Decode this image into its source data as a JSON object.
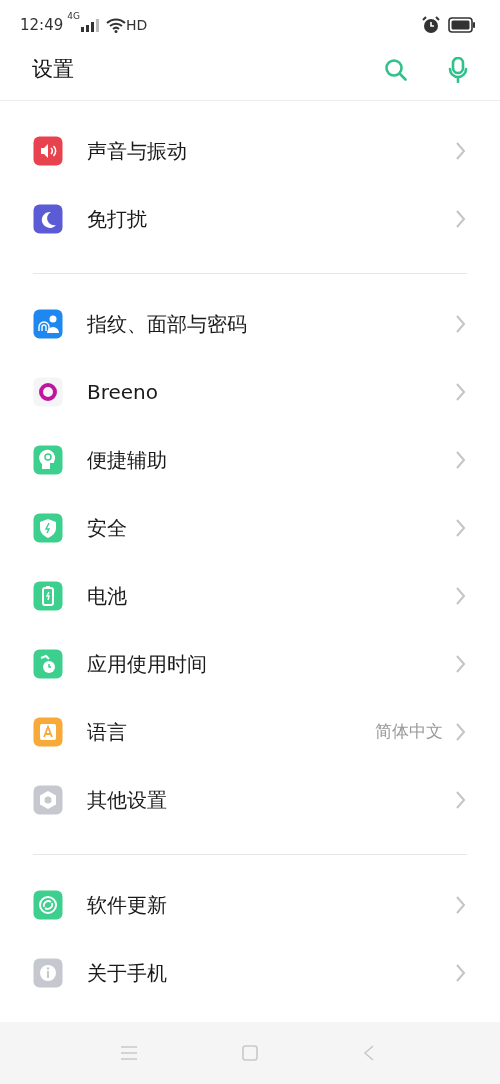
{
  "status_bar": {
    "time": "12:49",
    "network": "4G",
    "wifi_label": "HD"
  },
  "header": {
    "title": "设置"
  },
  "sections": [
    {
      "items": [
        {
          "label": "声音与振动",
          "color": "#e8424f"
        },
        {
          "label": "免打扰",
          "color": "#5b5bd6"
        }
      ]
    },
    {
      "items": [
        {
          "label": "指纹、面部与密码",
          "color": "#1e88f0"
        },
        {
          "label": "Breeno",
          "color": "#f5f5f7"
        },
        {
          "label": "便捷辅助",
          "color": "#3ccf8e"
        },
        {
          "label": "安全",
          "color": "#3ccf8e"
        },
        {
          "label": "电池",
          "color": "#3ccf8e"
        },
        {
          "label": "应用使用时间",
          "color": "#3ccf8e"
        },
        {
          "label": "语言",
          "value": "简体中文",
          "color": "#f7a93a"
        },
        {
          "label": "其他设置",
          "color": "#c6c8d0"
        }
      ]
    },
    {
      "items": [
        {
          "label": "软件更新",
          "color": "#3ccf8e"
        },
        {
          "label": "关于手机",
          "color": "#c6c8d0"
        }
      ]
    }
  ]
}
